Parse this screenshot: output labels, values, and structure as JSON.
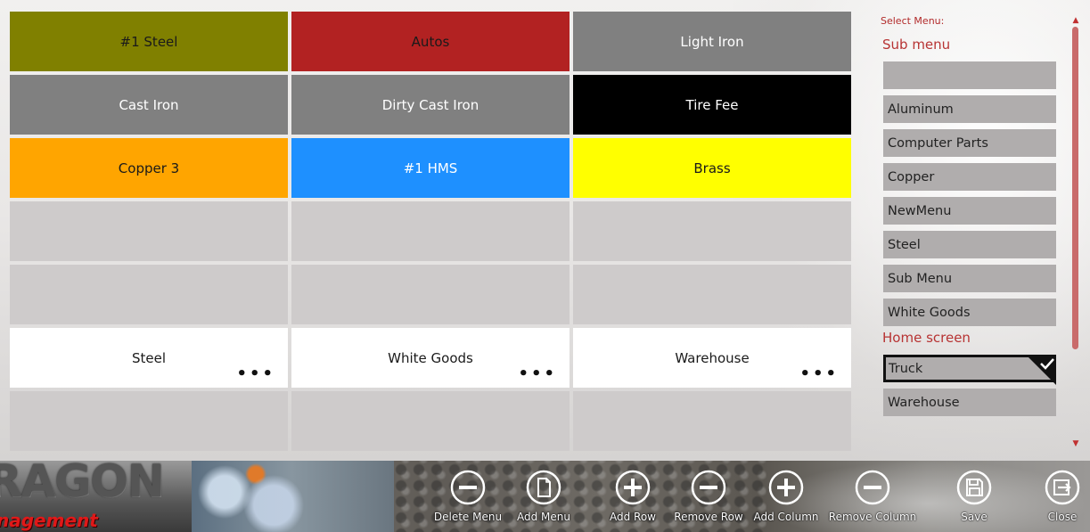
{
  "grid": {
    "tiles": [
      {
        "label": "#1 Steel",
        "bg": "#808000",
        "color": "#1a1a1a",
        "more": false
      },
      {
        "label": "Autos",
        "bg": "#b22222",
        "color": "#1a1a1a",
        "more": false
      },
      {
        "label": "Light Iron",
        "bg": "#808080",
        "color": "#ffffff",
        "more": false
      },
      {
        "label": "Cast Iron",
        "bg": "#808080",
        "color": "#ffffff",
        "more": false
      },
      {
        "label": "Dirty Cast Iron",
        "bg": "#808080",
        "color": "#ffffff",
        "more": false
      },
      {
        "label": "Tire Fee",
        "bg": "#000000",
        "color": "#ffffff",
        "more": false
      },
      {
        "label": "Copper 3",
        "bg": "#ffa500",
        "color": "#1a1a1a",
        "more": false
      },
      {
        "label": "#1 HMS",
        "bg": "#1e90ff",
        "color": "#ffffff",
        "more": false
      },
      {
        "label": "Brass",
        "bg": "#ffff00",
        "color": "#1a1a1a",
        "more": false
      },
      {
        "label": "",
        "bg": "#cecbcb",
        "color": "#1a1a1a",
        "more": false
      },
      {
        "label": "",
        "bg": "#cecbcb",
        "color": "#1a1a1a",
        "more": false
      },
      {
        "label": "",
        "bg": "#cecbcb",
        "color": "#1a1a1a",
        "more": false
      },
      {
        "label": "",
        "bg": "#cecbcb",
        "color": "#1a1a1a",
        "more": false
      },
      {
        "label": "",
        "bg": "#cecbcb",
        "color": "#1a1a1a",
        "more": false
      },
      {
        "label": "",
        "bg": "#cecbcb",
        "color": "#1a1a1a",
        "more": false
      },
      {
        "label": "Steel",
        "bg": "#ffffff",
        "color": "#1a1a1a",
        "more": true
      },
      {
        "label": "White Goods",
        "bg": "#ffffff",
        "color": "#1a1a1a",
        "more": true
      },
      {
        "label": "Warehouse",
        "bg": "#ffffff",
        "color": "#1a1a1a",
        "more": true
      },
      {
        "label": "",
        "bg": "#cecbcb",
        "color": "#1a1a1a",
        "more": false
      },
      {
        "label": "",
        "bg": "#cecbcb",
        "color": "#1a1a1a",
        "more": false
      },
      {
        "label": "",
        "bg": "#cecbcb",
        "color": "#1a1a1a",
        "more": false
      }
    ],
    "more_glyph": "•••"
  },
  "panel": {
    "title": "Select Menu:",
    "sub_menu_heading": "Sub menu",
    "sub_menu_items": [
      "",
      "Aluminum",
      "Computer Parts",
      "Copper",
      "NewMenu",
      "Steel",
      "Sub Menu",
      "White Goods"
    ],
    "home_screen_heading": "Home screen",
    "home_screen_items": [
      "Truck",
      "Warehouse"
    ],
    "selected_home_item": "Truck",
    "scroll_up": "▲",
    "scroll_down": "▼"
  },
  "branding": {
    "logo_main": "RAGON",
    "logo_tagline": "nagement Simplified"
  },
  "toolbar": {
    "buttons": [
      {
        "id": "delete-menu",
        "label": "Delete Menu",
        "icon": "minus-circle-icon"
      },
      {
        "id": "add-menu",
        "label": "Add Menu",
        "icon": "document-circle-icon"
      },
      {
        "id": "add-row",
        "label": "Add Row",
        "icon": "plus-circle-icon"
      },
      {
        "id": "remove-row",
        "label": "Remove Row",
        "icon": "minus-circle-icon"
      },
      {
        "id": "add-column",
        "label": "Add Column",
        "icon": "plus-circle-icon"
      },
      {
        "id": "remove-column",
        "label": "Remove Column",
        "icon": "minus-circle-icon"
      },
      {
        "id": "save",
        "label": "Save",
        "icon": "floppy-disk-icon"
      },
      {
        "id": "close",
        "label": "Close",
        "icon": "exit-icon"
      }
    ]
  },
  "colors": {
    "accent_red": "#b22a2a",
    "menu_item_bg": "#b0adad",
    "scroll_thumb": "#c96b6b"
  }
}
